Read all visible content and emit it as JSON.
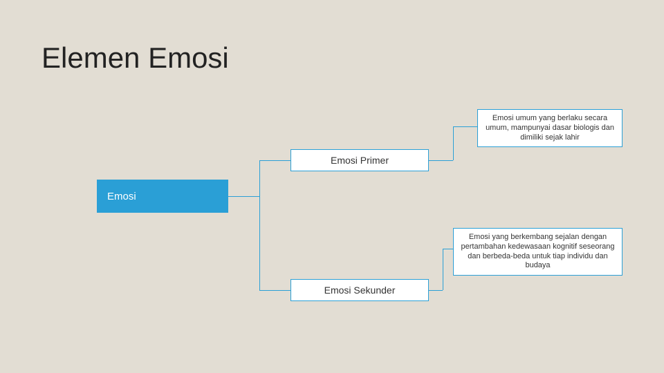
{
  "title": "Elemen Emosi",
  "diagram": {
    "root": {
      "label": "Emosi"
    },
    "branches": [
      {
        "mid_label": "Emosi Primer",
        "desc": "Emosi umum yang berlaku secara umum, mampunyai dasar biologis dan dimiliki sejak lahir"
      },
      {
        "mid_label": "Emosi Sekunder",
        "desc": "Emosi yang berkembang sejalan dengan pertambahan kedewasaan kognitif seseorang dan berbeda-beda untuk tiap individu dan budaya"
      }
    ]
  },
  "colors": {
    "background": "#e2ddd3",
    "accent": "#2a9fd6",
    "text_dark": "#222"
  }
}
